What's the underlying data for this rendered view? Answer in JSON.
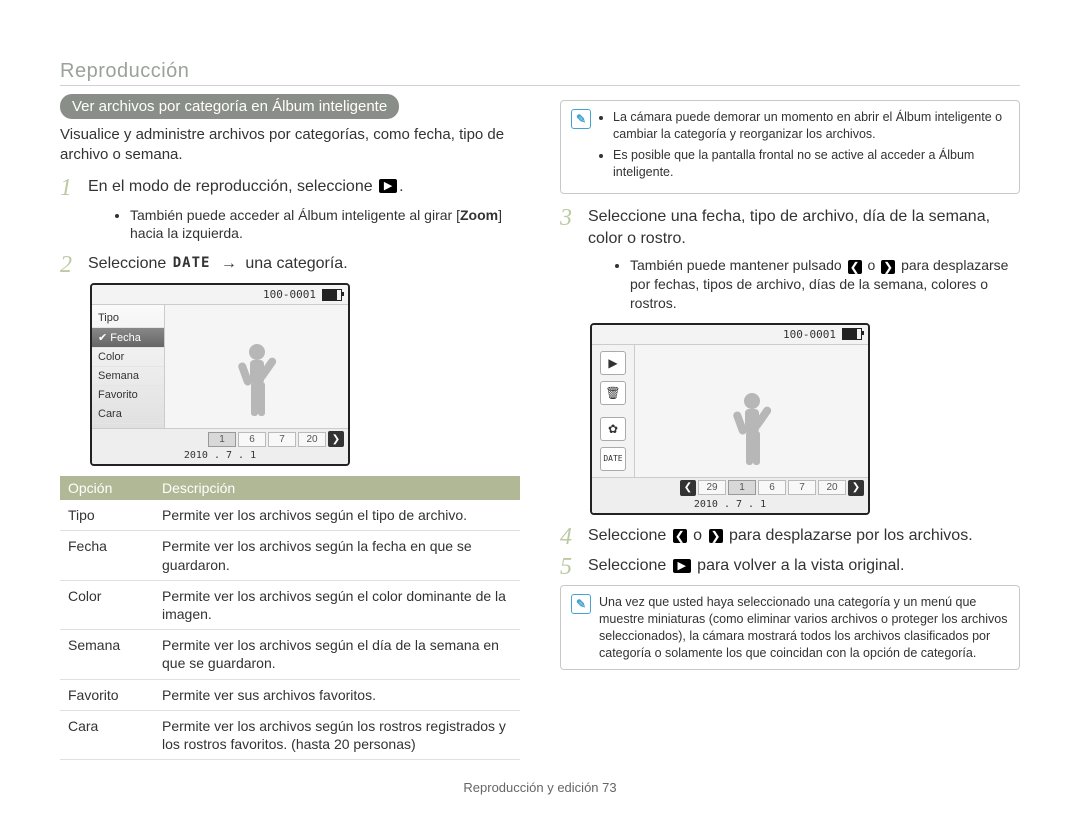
{
  "section_title": "Reproducción",
  "pill": "Ver archivos por categoría en Álbum inteligente",
  "intro": "Visualice y administre archivos por categorías, como fecha, tipo de archivo o semana.",
  "steps": {
    "s1_text": "En el modo de reproducción, seleccione ",
    "s1_bullet_a": "También puede acceder al Álbum inteligente al girar [",
    "s1_bullet_zoom": "Zoom",
    "s1_bullet_b": "] hacia la izquierda.",
    "s2_a": "Seleccione ",
    "s2_date": "DATE",
    "s2_b": " una categoría.",
    "s3": "Seleccione una fecha, tipo de archivo, día de la semana, color o rostro.",
    "s3_bullet_a": "También puede mantener pulsado ",
    "s3_bullet_b": " o ",
    "s3_bullet_c": " para desplazarse por fechas, tipos de archivo, días de la semana, colores o rostros.",
    "s4_a": "Seleccione ",
    "s4_b": " o ",
    "s4_c": " para desplazarse por los archivos.",
    "s5_a": "Seleccione ",
    "s5_b": " para volver a la vista original."
  },
  "note1": [
    "La cámara puede demorar un momento en abrir el Álbum inteligente o cambiar la categoría y reorganizar los archivos.",
    "Es posible que la pantalla frontal no se active al acceder a Álbum inteligente."
  ],
  "note2": "Una vez que usted haya seleccionado una categoría y un menú que muestre miniaturas (como eliminar varios archivos o proteger los archivos seleccionados), la cámara mostrará todos los archivos clasificados por categoría o solamente los que coincidan con la opción de categoría.",
  "cam1": {
    "counter": "100-0001",
    "menu": [
      "Tipo",
      "Fecha",
      "Color",
      "Semana",
      "Favorito",
      "Cara"
    ],
    "menu_selected_index": 1,
    "strip": [
      "1",
      "6",
      "7",
      "20"
    ],
    "date": "2010 . 7 . 1"
  },
  "cam2": {
    "counter": "100-0001",
    "toolbar_date": "DATE",
    "strip": [
      "29",
      "1",
      "6",
      "7",
      "20"
    ],
    "date": "2010 . 7 . 1"
  },
  "table": {
    "headers": [
      "Opción",
      "Descripción"
    ],
    "rows": [
      [
        "Tipo",
        "Permite ver los archivos según el tipo de archivo."
      ],
      [
        "Fecha",
        "Permite ver los archivos según la fecha en que se guardaron."
      ],
      [
        "Color",
        "Permite ver los archivos según el color dominante de la imagen."
      ],
      [
        "Semana",
        "Permite ver los archivos según el día de la semana en que se guardaron."
      ],
      [
        "Favorito",
        "Permite ver sus archivos favoritos."
      ],
      [
        "Cara",
        "Permite ver los archivos según los rostros registrados y los rostros favoritos. (hasta 20 personas)"
      ]
    ]
  },
  "footer": "Reproducción y edición  73",
  "glyphs": {
    "arrow_right": "→",
    "chev_left": "❮",
    "chev_right": "❯",
    "play": "▶",
    "trash": "🗑",
    "gear": "✿",
    "check": "✔"
  }
}
